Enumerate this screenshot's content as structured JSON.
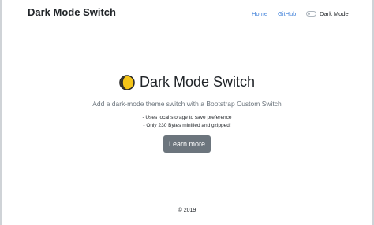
{
  "navbar": {
    "brand": "Dark Mode Switch",
    "links": [
      "Home",
      "GitHub"
    ],
    "switch_label": "Dark Mode",
    "switch_checked": false
  },
  "hero": {
    "title": "Dark Mode Switch",
    "icon": "moon-icon",
    "lead": "Add a dark-mode theme switch with a Bootstrap Custom Switch",
    "features": [
      "- Uses local storage to save preference",
      "- Only 230 Bytes minified and gzipped!"
    ],
    "button_label": "Learn more"
  },
  "footer": {
    "text": "© 2019"
  },
  "colors": {
    "link": "#3d7fd9",
    "button": "#6c757d",
    "icon_fill": "#f5c518"
  }
}
